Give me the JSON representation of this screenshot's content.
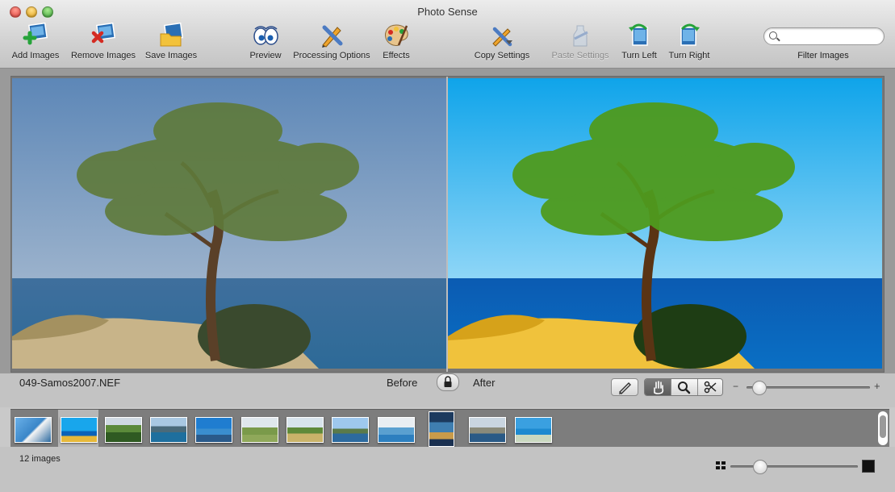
{
  "window": {
    "title": "Photo Sense"
  },
  "toolbar": {
    "add_images": "Add Images",
    "remove_images": "Remove Images",
    "save_images": "Save Images",
    "preview": "Preview",
    "processing_options": "Processing Options",
    "effects": "Effects",
    "copy_settings": "Copy Settings",
    "paste_settings": "Paste Settings",
    "turn_left": "Turn Left",
    "turn_right": "Turn Right",
    "filter_images": "Filter Images",
    "search_value": ""
  },
  "preview": {
    "filename": "049-Samos2007.NEF",
    "before_label": "Before",
    "after_label": "After"
  },
  "zoom": {
    "minus": "−",
    "plus": "+",
    "level": 0.05
  },
  "filmstrip": {
    "count_label": "12 images",
    "selected_index": 1,
    "thumb_size_level": 0.2
  },
  "colors": {
    "accent": "#6a6a6a",
    "toolbar_bg": "#d2d2d2"
  }
}
